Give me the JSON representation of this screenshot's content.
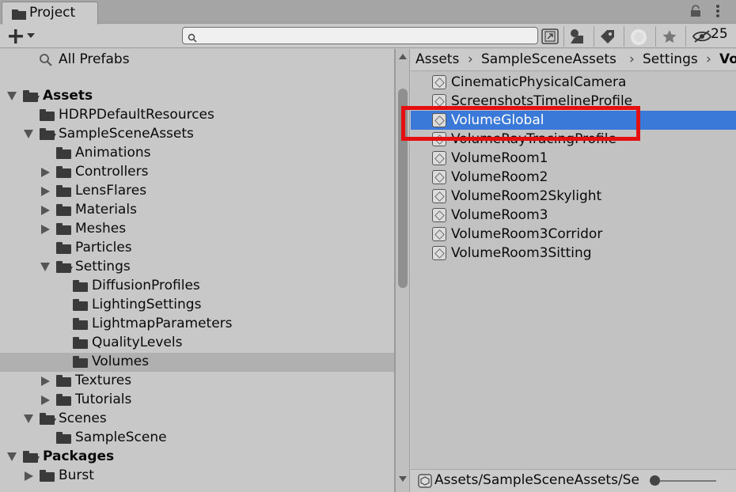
{
  "window": {
    "tab_label": "Project",
    "hidden_packages_count": "25"
  },
  "toolbar": {
    "search_placeholder": "",
    "icons": [
      "plus-icon",
      "search-mode-icon",
      "filter-type-icon",
      "filter-label-icon",
      "log-icon",
      "favorite-icon",
      "hidden-packages-icon"
    ]
  },
  "tree": {
    "items": [
      {
        "label": "All Prefabs"
      },
      {
        "label": "Assets"
      },
      {
        "label": "HDRPDefaultResources"
      },
      {
        "label": "SampleSceneAssets"
      },
      {
        "label": "Animations"
      },
      {
        "label": "Controllers"
      },
      {
        "label": "LensFlares"
      },
      {
        "label": "Materials"
      },
      {
        "label": "Meshes"
      },
      {
        "label": "Particles"
      },
      {
        "label": "Settings"
      },
      {
        "label": "DiffusionProfiles"
      },
      {
        "label": "LightingSettings"
      },
      {
        "label": "LightmapParameters"
      },
      {
        "label": "QualityLevels"
      },
      {
        "label": "Volumes"
      },
      {
        "label": "Textures"
      },
      {
        "label": "Tutorials"
      },
      {
        "label": "Scenes"
      },
      {
        "label": "SampleScene"
      },
      {
        "label": "Packages"
      },
      {
        "label": "Burst"
      }
    ]
  },
  "breadcrumb": [
    "Assets",
    "SampleSceneAssets",
    "Settings",
    "Vo"
  ],
  "files": [
    {
      "label": "CinematicPhysicalCamera"
    },
    {
      "label": "ScreenshotsTimelineProfile"
    },
    {
      "label": "VolumeGlobal"
    },
    {
      "label": "VolumeRayTracingProfile"
    },
    {
      "label": "VolumeRoom1"
    },
    {
      "label": "VolumeRoom2"
    },
    {
      "label": "VolumeRoom2Skylight"
    },
    {
      "label": "VolumeRoom3"
    },
    {
      "label": "VolumeRoom3Corridor"
    },
    {
      "label": "VolumeRoom3Sitting"
    }
  ],
  "status": {
    "path": "Assets/SampleSceneAssets/Se"
  },
  "colors": {
    "selection": "#3a79d8",
    "highlight_box": "#e60f0f"
  }
}
